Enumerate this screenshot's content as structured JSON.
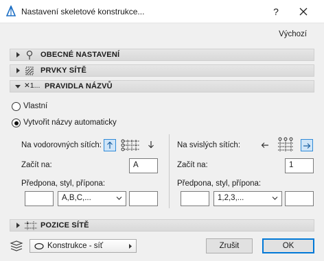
{
  "dialog": {
    "title": "Nastavení skeletové konstrukce...",
    "help_label": "?",
    "default_label": "Výchozí"
  },
  "sections": [
    {
      "label": "OBECNÉ NASTAVENÍ",
      "icon": "pin-icon",
      "expanded": false
    },
    {
      "label": "PRVKY SÍTĚ",
      "icon": "grid-elements-icon",
      "expanded": false
    },
    {
      "label": "PRAVIDLA NÁZVŮ",
      "icon_text": "✕1...",
      "icon": "naming-rules-icon",
      "expanded": true
    },
    {
      "label": "POZICE SÍTĚ",
      "icon": "grid-position-icon",
      "expanded": false
    }
  ],
  "naming": {
    "option_custom": "Vlastní",
    "option_auto": "Vytvořit názvy automaticky",
    "selected": "auto",
    "horizontal": {
      "label": "Na vodorovných sítích:",
      "start_label": "Začít na:",
      "start_value": "A",
      "format_label": "Předpona, styl, přípona:",
      "prefix": "",
      "style": "A,B,C,...",
      "suffix": "",
      "direction": "up"
    },
    "vertical": {
      "label": "Na svislých sítích:",
      "start_label": "Začít na:",
      "start_value": "1",
      "format_label": "Předpona, styl, přípona:",
      "prefix": "",
      "style": "1,2,3,...",
      "suffix": "",
      "direction": "right"
    }
  },
  "footer": {
    "layer": "Konstrukce - síť",
    "cancel_label": "Zrušit",
    "ok_label": "OK"
  },
  "colors": {
    "accent": "#0078d7",
    "active_toggle_bg": "#cfe5f8"
  }
}
